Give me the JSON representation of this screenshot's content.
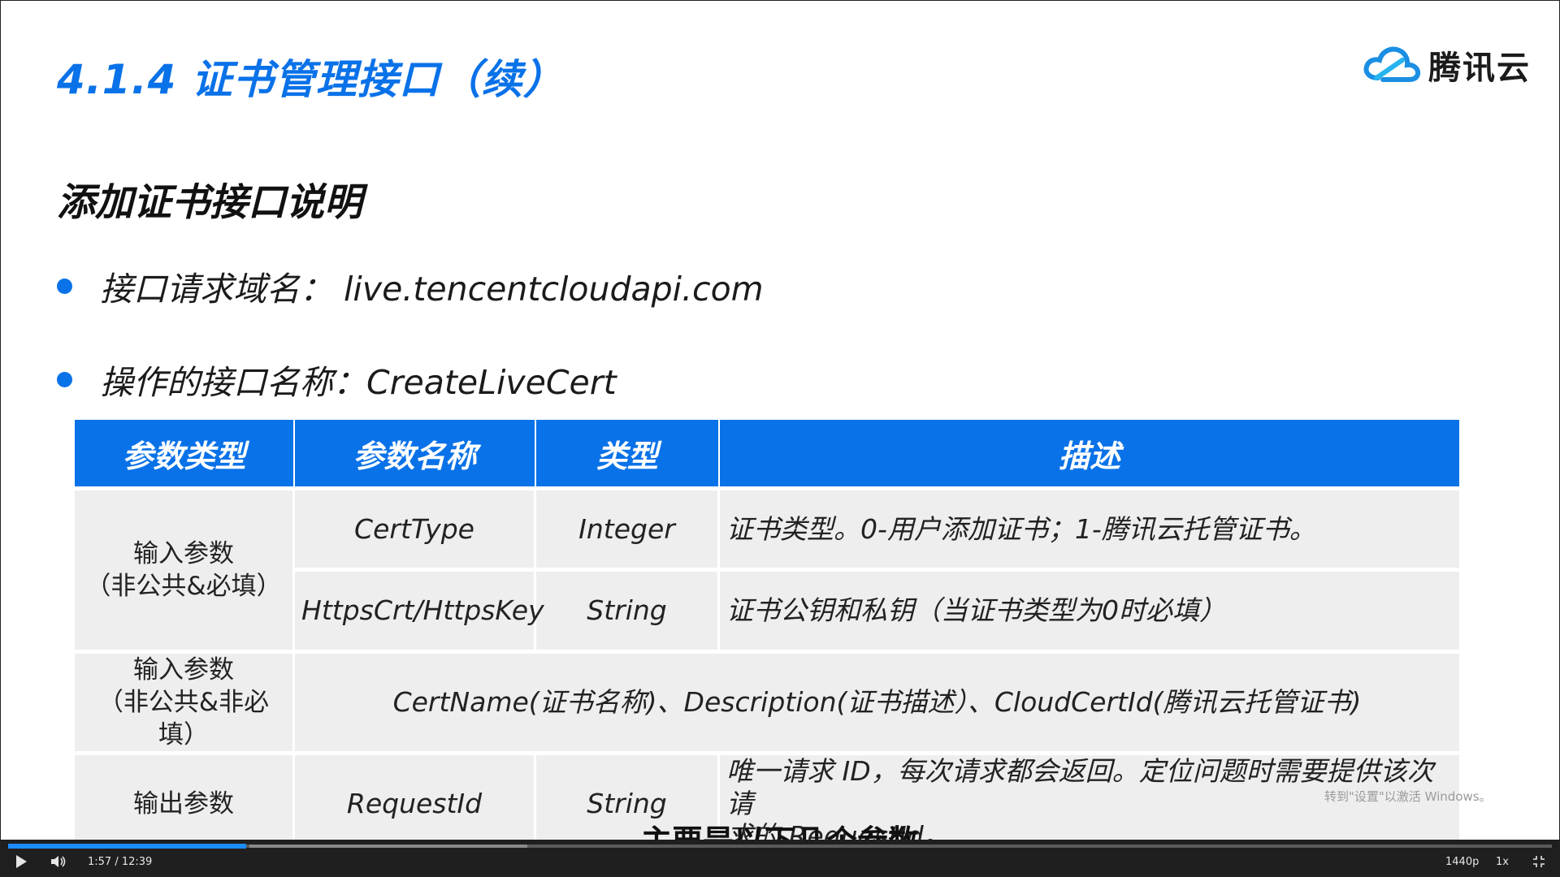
{
  "slide": {
    "title": "4.1.4  证书管理接口（续）",
    "logo_text": "腾讯云",
    "section_heading": "添加证书接口说明",
    "bullets": [
      "接口请求域名：  live.tencentcloudapi.com",
      "操作的接口名称：CreateLiveCert"
    ]
  },
  "table": {
    "headers": [
      "参数类型",
      "参数名称",
      "类型",
      "描述"
    ],
    "rows": [
      {
        "category_line1": "输入参数",
        "category_line2": "（非公共&必填）",
        "name": "CertType",
        "type": "Integer",
        "desc": "证书类型。0-用户添加证书；1-腾讯云托管证书。"
      },
      {
        "name": "HttpsCrt/HttpsKey",
        "type": "String",
        "desc": "证书公钥和私钥（当证书类型为0时必填）"
      },
      {
        "category_line1": "输入参数",
        "category_line2": "（非公共&非必填）",
        "merged": "CertName(证书名称)、Description(证书描述）、CloudCertId(腾讯云托管证书)"
      },
      {
        "category": "输出参数",
        "name": "RequestId",
        "type": "String",
        "desc_line1": "唯一请求 ID，每次请求都会返回。定位问题时需要提供该次请",
        "desc_line2": "求的 RequestId。"
      }
    ]
  },
  "overlay": {
    "windows_watermark": "转到\"设置\"以激活 Windows。",
    "subtitle": "主要是以下几个参数"
  },
  "player": {
    "time": "1:57 / 12:39",
    "quality": "1440p",
    "speed": "1x",
    "progress_fraction": 0.154,
    "icons": [
      "play-icon",
      "volume-icon",
      "fullscreen-exit-icon"
    ],
    "accent_color": "#1c8cff"
  },
  "colors": {
    "brand_blue": "#0a72e8",
    "table_cell_bg": "#eeeeee"
  }
}
